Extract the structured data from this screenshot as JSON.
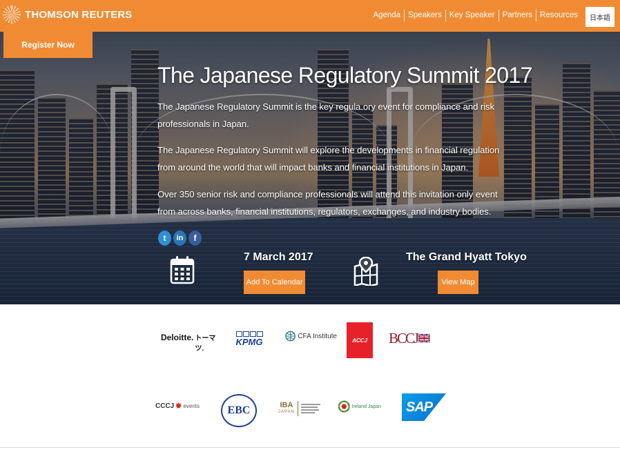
{
  "nav": {
    "brand": "THOMSON REUTERS",
    "items": [
      {
        "label": "Agenda"
      },
      {
        "label": "Speakers"
      },
      {
        "label": "Key Speaker"
      },
      {
        "label": "Partners"
      },
      {
        "label": "Resources"
      }
    ],
    "language_button": "日本語"
  },
  "register_button": "Register Now",
  "hero": {
    "title": "The Japanese Regulatory Summit 2017",
    "paragraphs": [
      "The Japanese Regulatory Summit is the key regula.ory event for compliance and risk professionals in Japan.",
      "The Japanese Regulatory Summit will explore the developments in financial regulation from around the world that will impact banks and financial institutions in Japan.",
      "Over 350 senior risk and compliance professionals will attend this invitation only event from across banks, financial institutions, regulators, exchanges, and industry bodies."
    ],
    "social": [
      {
        "icon": "twitter-icon",
        "glyph": "t"
      },
      {
        "icon": "linkedin-icon",
        "glyph": "in"
      },
      {
        "icon": "facebook-icon",
        "glyph": "f"
      }
    ]
  },
  "event": {
    "date": "7 March 2017",
    "calendar_button": "Add To Calendar",
    "venue": "The Grand Hyatt Tokyo",
    "map_button": "View Map"
  },
  "sponsors": {
    "row1": [
      {
        "name": "deloitte-logo",
        "text": "Deloitte.",
        "subtext": "トーマツ."
      },
      {
        "name": "kpmg-logo",
        "text": "KPMG"
      },
      {
        "name": "cfa-institute-logo",
        "text": "CFA Institute"
      },
      {
        "name": "acci-logo",
        "text": "ACCJ"
      },
      {
        "name": "bccj-logo",
        "text": "BCCJ"
      }
    ],
    "row2": [
      {
        "name": "cccj-logo",
        "text": "CCCJ",
        "subtext": "events"
      },
      {
        "name": "ebc-logo",
        "text": "EBC"
      },
      {
        "name": "iba-japan-logo",
        "text": "IBA",
        "subtext": "JAPAN"
      },
      {
        "name": "ireland-japan-chamber-logo",
        "text": "Ireland Japan"
      },
      {
        "name": "sap-logo",
        "text": "SAP"
      }
    ]
  },
  "colors": {
    "brand_orange": "#f08b33",
    "white": "#ffffff",
    "accj_red": "#e8202a",
    "sap_blue": "#0a6ed1",
    "kpmg_blue": "#1b3f95"
  }
}
